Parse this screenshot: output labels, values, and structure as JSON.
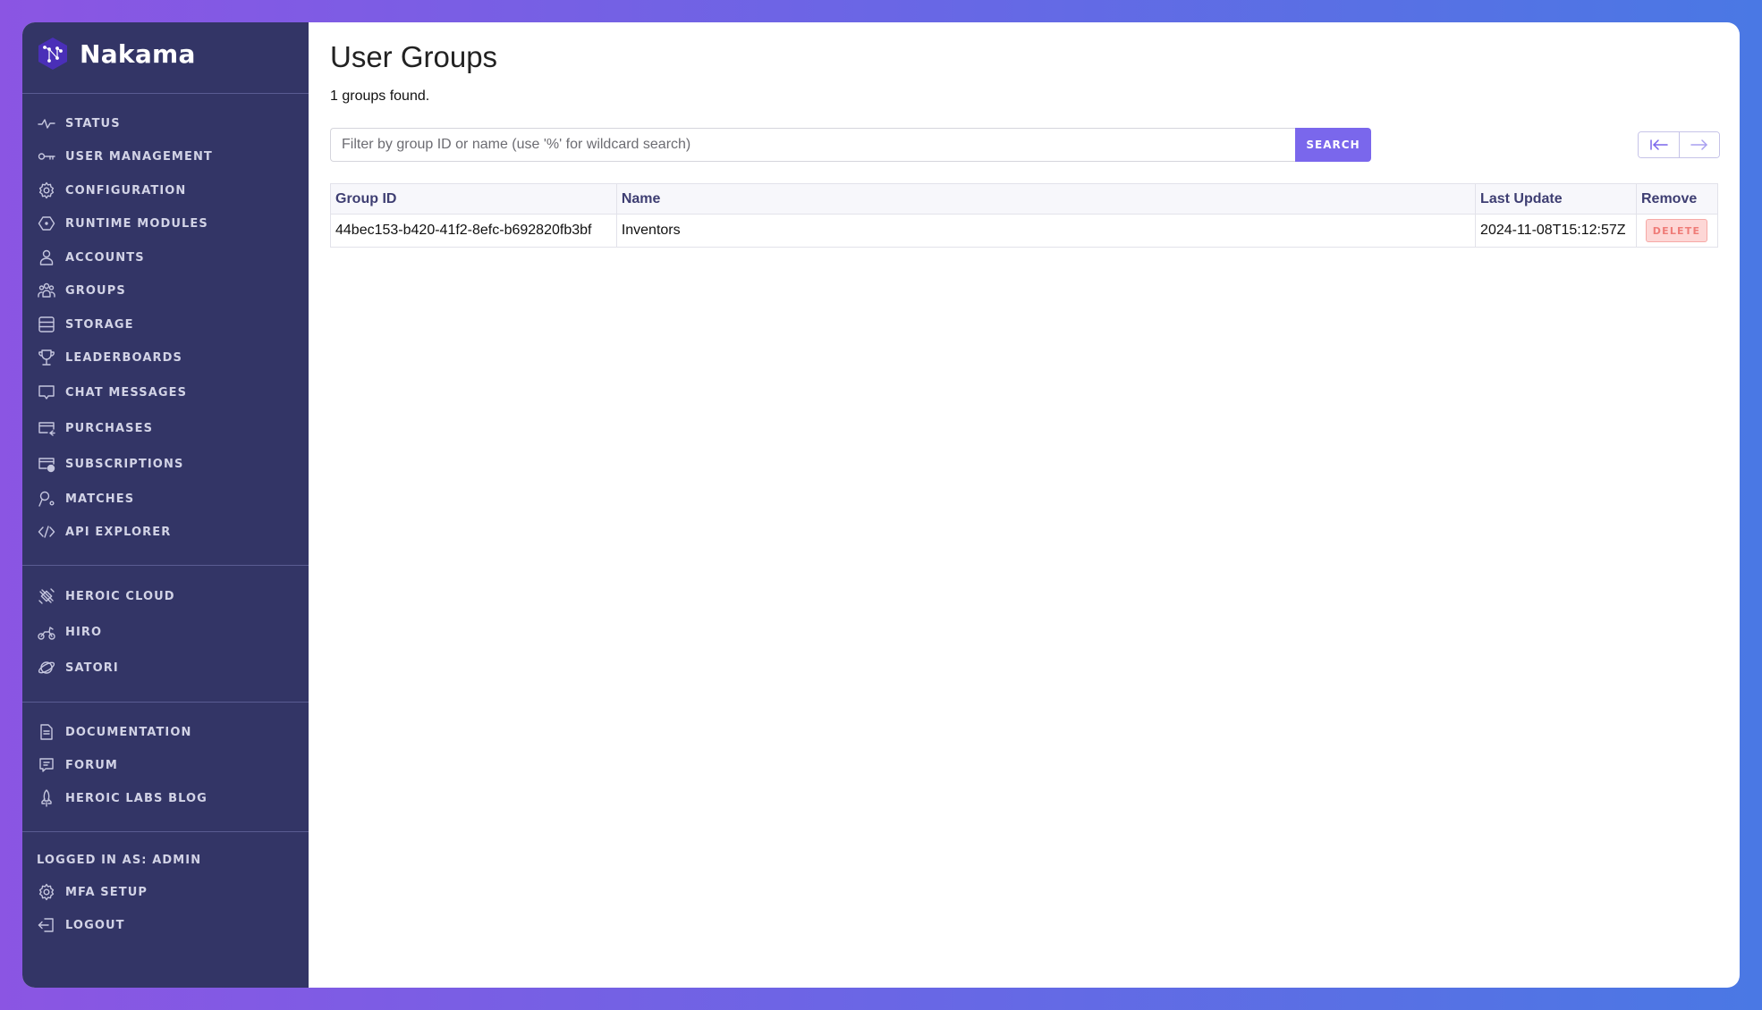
{
  "app": {
    "name": "Nakama"
  },
  "sidebar": {
    "primary": [
      {
        "label": "Status",
        "icon": "activity-icon"
      },
      {
        "label": "User Management",
        "icon": "key-icon"
      },
      {
        "label": "Configuration",
        "icon": "gear-icon"
      },
      {
        "label": "Runtime Modules",
        "icon": "hexagon-icon"
      },
      {
        "label": "Accounts",
        "icon": "user-icon"
      },
      {
        "label": "Groups",
        "icon": "users-icon"
      },
      {
        "label": "Storage",
        "icon": "database-icon"
      },
      {
        "label": "Leaderboards",
        "icon": "trophy-icon"
      },
      {
        "label": "Chat Messages",
        "icon": "chat-bubble-icon"
      },
      {
        "label": "Purchases",
        "icon": "credit-card-icon"
      },
      {
        "label": "Subscriptions",
        "icon": "card-clock-icon"
      },
      {
        "label": "Matches",
        "icon": "match-icon"
      },
      {
        "label": "API Explorer",
        "icon": "code-icon"
      }
    ],
    "products": [
      {
        "label": "Heroic Cloud",
        "icon": "cloud-satellite-icon"
      },
      {
        "label": "Hiro",
        "icon": "bike-icon"
      },
      {
        "label": "Satori",
        "icon": "planet-icon"
      }
    ],
    "resources": [
      {
        "label": "Documentation",
        "icon": "document-icon"
      },
      {
        "label": "Forum",
        "icon": "forum-icon"
      },
      {
        "label": "Heroic Labs Blog",
        "icon": "rocket-icon"
      }
    ],
    "account": {
      "logged_in_label": "LOGGED IN AS: ADMIN",
      "items": [
        {
          "label": "MFA Setup",
          "icon": "gear-icon"
        },
        {
          "label": "Logout",
          "icon": "logout-icon"
        }
      ]
    }
  },
  "main": {
    "title": "User Groups",
    "count_text": "1 groups found.",
    "search": {
      "placeholder": "Filter by group ID or name (use '%' for wildcard search)",
      "value": "",
      "button_label": "SEARCH"
    },
    "pagination": {
      "first_icon": "first-page-icon",
      "next_icon": "arrow-right-icon"
    },
    "table": {
      "columns": [
        "Group ID",
        "Name",
        "Last Update",
        "Remove"
      ],
      "rows": [
        {
          "group_id": "44bec153-b420-41f2-8efc-b692820fb3bf",
          "name": "Inventors",
          "last_update": "2024-11-08T15:12:57Z",
          "remove_label": "DELETE"
        }
      ]
    }
  },
  "colors": {
    "sidebar_bg": "#333566",
    "accent": "#7a67ec",
    "delete_bg": "#fdd7d6",
    "delete_text": "#ef7c78",
    "header_text": "#3e3e72"
  }
}
